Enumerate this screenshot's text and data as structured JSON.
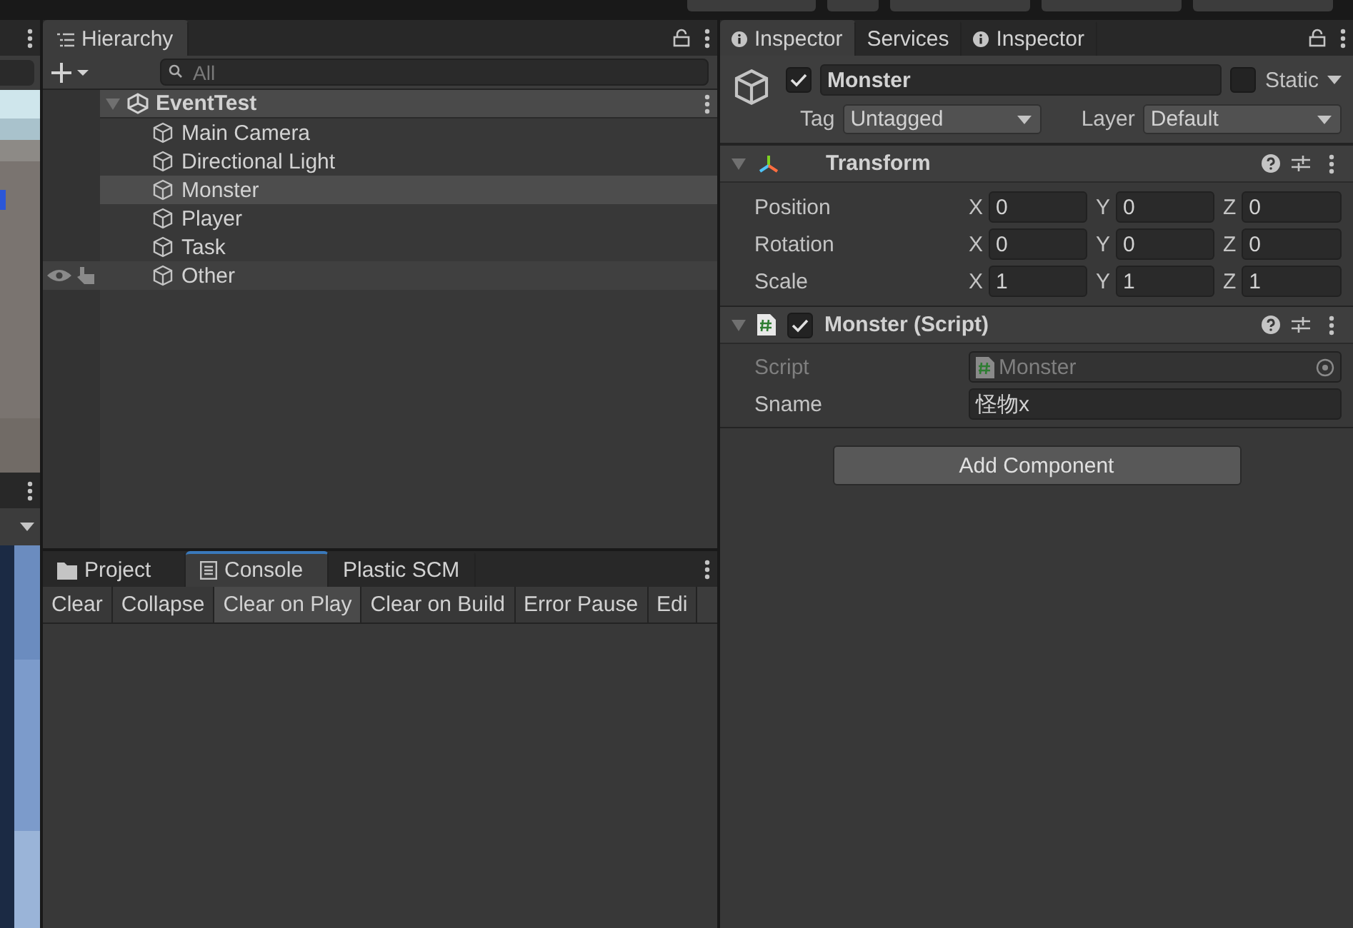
{
  "hierarchy": {
    "tab": "Hierarchy",
    "search": {
      "placeholder": "All"
    },
    "scene": {
      "name": "EventTest",
      "expanded": true
    },
    "items": [
      {
        "name": "Main Camera",
        "selected": false,
        "hovered": false
      },
      {
        "name": "Directional Light",
        "selected": false,
        "hovered": false
      },
      {
        "name": "Monster",
        "selected": true,
        "hovered": false
      },
      {
        "name": "Player",
        "selected": false,
        "hovered": false
      },
      {
        "name": "Task",
        "selected": false,
        "hovered": false
      },
      {
        "name": "Other",
        "selected": false,
        "hovered": true
      }
    ]
  },
  "bottom_tabs": [
    {
      "label": "Project",
      "kind": "folder",
      "selected": false
    },
    {
      "label": "Console",
      "kind": "console",
      "selected": true
    },
    {
      "label": "Plastic SCM",
      "kind": "plain",
      "selected": false
    }
  ],
  "console_toolbar": [
    {
      "label": "Clear",
      "on": false
    },
    {
      "label": "Collapse",
      "on": false
    },
    {
      "label": "Clear on Play",
      "on": true
    },
    {
      "label": "Clear on Build",
      "on": false
    },
    {
      "label": "Error Pause",
      "on": false
    },
    {
      "label": "Edi",
      "on": false
    }
  ],
  "inspector": {
    "tabs": [
      {
        "label": "Inspector",
        "kind": "info",
        "selected": true
      },
      {
        "label": "Services",
        "kind": "plain",
        "selected": false
      },
      {
        "label": "Inspector",
        "kind": "info",
        "selected": false
      }
    ],
    "object": {
      "active": true,
      "name": "Monster",
      "static": false,
      "static_label": "Static",
      "tag_label": "Tag",
      "tag": "Untagged",
      "layer_label": "Layer",
      "layer": "Default"
    },
    "transform": {
      "title": "Transform",
      "expanded": true,
      "rows": [
        {
          "label": "Position",
          "fields": [
            {
              "axis": "X",
              "value": "0"
            },
            {
              "axis": "Y",
              "value": "0"
            },
            {
              "axis": "Z",
              "value": "0"
            }
          ]
        },
        {
          "label": "Rotation",
          "fields": [
            {
              "axis": "X",
              "value": "0"
            },
            {
              "axis": "Y",
              "value": "0"
            },
            {
              "axis": "Z",
              "value": "0"
            }
          ]
        },
        {
          "label": "Scale",
          "fields": [
            {
              "axis": "X",
              "value": "1"
            },
            {
              "axis": "Y",
              "value": "1"
            },
            {
              "axis": "Z",
              "value": "1"
            }
          ]
        }
      ]
    },
    "script": {
      "title": "Monster (Script)",
      "enabled": true,
      "expanded": true,
      "fields": [
        {
          "label": "Script",
          "value": "Monster",
          "kind": "object",
          "disabled": true
        },
        {
          "label": "Sname",
          "value": "怪物x",
          "kind": "text",
          "disabled": false
        }
      ]
    },
    "add_component": "Add Component"
  }
}
